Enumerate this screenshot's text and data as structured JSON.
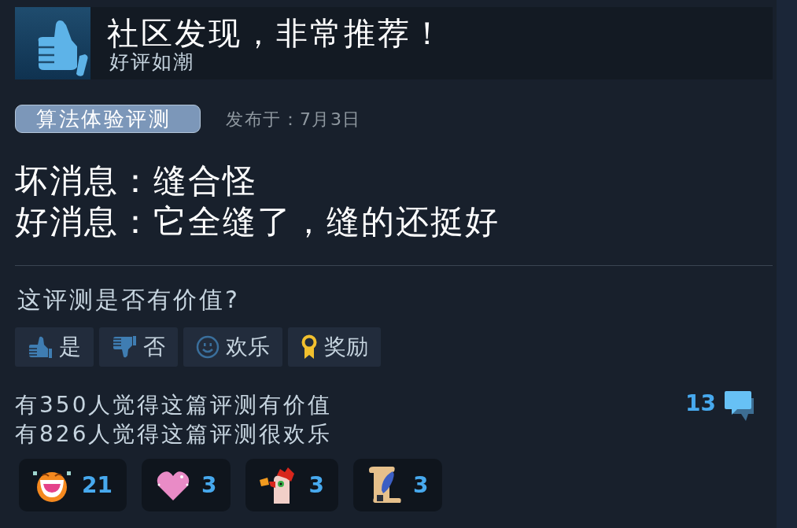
{
  "banner": {
    "title": "社区发现，非常推荐！",
    "rating": "好评如潮"
  },
  "review": {
    "tag": "算法体验评测",
    "date": "发布于：7月3日",
    "lines": [
      "坏消息：缝合怪",
      "好消息：它全缝了，缝的还挺好"
    ]
  },
  "helpful": {
    "question": "这评测是否有价值?",
    "buttons": [
      {
        "kind": "yes",
        "label": "是"
      },
      {
        "kind": "no",
        "label": "否"
      },
      {
        "kind": "funny",
        "label": "欢乐"
      },
      {
        "kind": "award",
        "label": "奖励"
      }
    ]
  },
  "stats": {
    "lines": [
      "有350人觉得这篇评测有价值",
      "有826人觉得这篇评测很欢乐"
    ],
    "comment_count": "13"
  },
  "awards": [
    {
      "kind": "laugh",
      "count": "21"
    },
    {
      "kind": "heart",
      "count": "3"
    },
    {
      "kind": "rooster",
      "count": "3"
    },
    {
      "kind": "scroll",
      "count": "3"
    }
  ]
}
